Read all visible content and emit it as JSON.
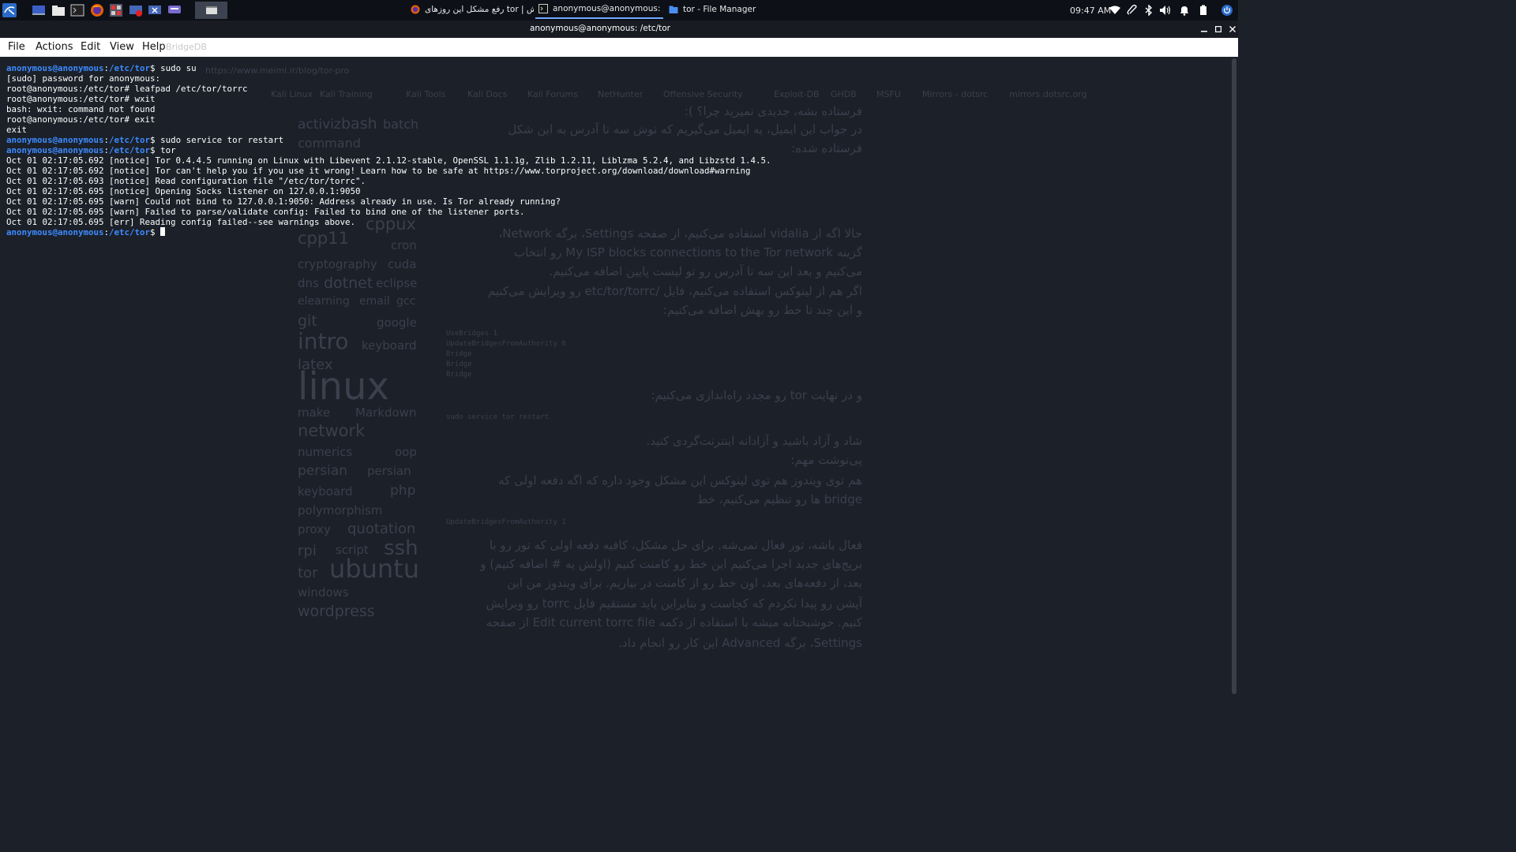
{
  "taskbar": {
    "tasks": [
      {
        "label": "رفع مشکل این روزهای tor | اش...",
        "icon": "firefox-icon"
      },
      {
        "label": "anonymous@anonymous: /et...",
        "icon": "terminal-icon"
      },
      {
        "label": "tor - File Manager",
        "icon": "folder-icon"
      }
    ],
    "clock": "09:47 AM"
  },
  "window": {
    "title": "anonymous@anonymous: /etc/tor"
  },
  "menu": {
    "file": "File",
    "actions": "Actions",
    "edit": "Edit",
    "view": "View",
    "help": "Help"
  },
  "background_browser": {
    "tab_title": "BridgeDB",
    "url": "https://www.meimi.ir/blog/tor-pro",
    "bookmarks": [
      "Kali Linux",
      "Kali Training",
      "Kali Tools",
      "Kali Docs",
      "Kali Forums",
      "NetHunter",
      "Offensive Security",
      "Exploit-DB",
      "GHDB",
      "MSFU",
      "Mirrors - dotsrc",
      "mirrors.dotsrc.org"
    ],
    "tags": [
      "activiz",
      "bash",
      "batch",
      "command",
      "cppux",
      "cpp11",
      "cron",
      "cryptography",
      "cuda",
      "dns",
      "dotnet",
      "eclipse",
      "elearning",
      "email",
      "gcc",
      "git",
      "google",
      "intro",
      "keyboard",
      "latex",
      "linux",
      "make",
      "Markdown",
      "network",
      "numerics",
      "oop",
      "persian",
      "persian",
      "keyboard",
      "php",
      "polymorphism",
      "proxy",
      "quotation",
      "rpi",
      "script",
      "ssh",
      "tor",
      "ubuntu",
      "windows",
      "wordpress"
    ],
    "article_lines": [
      "فرستاده بشه، جدیدی نمیرید چرا؟ ):",
      "در جواب این ایمیل، یه ایمیل می‌گیریم که توش سه تا آدرس به این شکل",
      "فرستاده شده:",
      "حالا اگه از vidalia استفاده می‌کنیم، از صفحه Settings، برگه Network،",
      "گزینه My ISP blocks connections to the Tor network رو انتخاب",
      "می‌کنیم و بعد این سه تا آدرس رو تو لیست پایین اضافه می‌کنیم.",
      "اگر هم از لینوکس استفاده می‌کنیم، فایل /etc/tor/torrc رو ویرایش می‌کنیم",
      "و این چند تا خط رو بهش اضافه می‌کنیم:",
      "و در نهایت tor رو مجدد راه‌اندازی می‌کنیم:",
      "شاد و آزاد باشید و آزادانه اینترنت‌گردی کنید.",
      "پی‌نوشت مهم:",
      "هم توی ویندوز هم توی لینوکس این مشکل وجود داره که اگه دفعه اولی که",
      "bridge ها رو تنظیم می‌کنیم، خط",
      "فعال باشه، تور فعال نمی‌شه. برای حل مشکل، کافیه دفعه اولی که تور رو با",
      "بریج‌های جدید اجرا می‌کنیم این خط رو کامنت کنیم (اولش یه # اضافه کنیم) و",
      "بعد، از دفعه‌های بعد، اون خط رو از کامنت در بیاریم. برای ویندوز من این",
      "آپشن رو پیدا نکردم که کجاست و بنابراین باید مستقیم فایل torrc رو ویرایش",
      "کنیم. خوشبختانه میشه با استفاده از دکمه Edit current torrc file از صفحه",
      "Settings، برگه Advanced این کار رو انجام داد."
    ],
    "code_lines": [
      "UseBridges 1",
      "UpdateBridgesFromAuthority 0",
      "Bridge",
      "Bridge",
      "Bridge",
      "sudo service tor restart",
      "UpdateBridgesFromAuthority 1"
    ]
  },
  "terminal": {
    "prompt_user": "anonymous@anonymous",
    "prompt_sep": ":",
    "lines": [
      {
        "type": "user",
        "path": "/etc/tor",
        "sign": "$ ",
        "cmd": "sudo su"
      },
      {
        "type": "out",
        "text": "[sudo] password for anonymous:"
      },
      {
        "type": "out",
        "text": "root@anonymous:/etc/tor# leafpad /etc/tor/torrc"
      },
      {
        "type": "out",
        "text": "root@anonymous:/etc/tor# wxit"
      },
      {
        "type": "out",
        "text": "bash: wxit: command not found"
      },
      {
        "type": "out",
        "text": "root@anonymous:/etc/tor# exit"
      },
      {
        "type": "out",
        "text": "exit"
      },
      {
        "type": "user",
        "path": "/etc/tor",
        "sign": "$ ",
        "cmd": "sudo service tor restart"
      },
      {
        "type": "user",
        "path": "/etc/tor",
        "sign": "$ ",
        "cmd": "tor"
      },
      {
        "type": "out",
        "text": "Oct 01 02:17:05.692 [notice] Tor 0.4.4.5 running on Linux with Libevent 2.1.12-stable, OpenSSL 1.1.1g, Zlib 1.2.11, Liblzma 5.2.4, and Libzstd 1.4.5."
      },
      {
        "type": "out",
        "text": "Oct 01 02:17:05.692 [notice] Tor can't help you if you use it wrong! Learn how to be safe at https://www.torproject.org/download/download#warning"
      },
      {
        "type": "out",
        "text": "Oct 01 02:17:05.693 [notice] Read configuration file \"/etc/tor/torrc\"."
      },
      {
        "type": "out",
        "text": "Oct 01 02:17:05.695 [notice] Opening Socks listener on 127.0.0.1:9050"
      },
      {
        "type": "out",
        "text": "Oct 01 02:17:05.695 [warn] Could not bind to 127.0.0.1:9050: Address already in use. Is Tor already running?"
      },
      {
        "type": "out",
        "text": "Oct 01 02:17:05.695 [warn] Failed to parse/validate config: Failed to bind one of the listener ports."
      },
      {
        "type": "out",
        "text": "Oct 01 02:17:05.695 [err] Reading config failed--see warnings above."
      },
      {
        "type": "user",
        "path": "/etc/tor",
        "sign": "$ ",
        "cmd": "",
        "cursor": true
      }
    ]
  }
}
